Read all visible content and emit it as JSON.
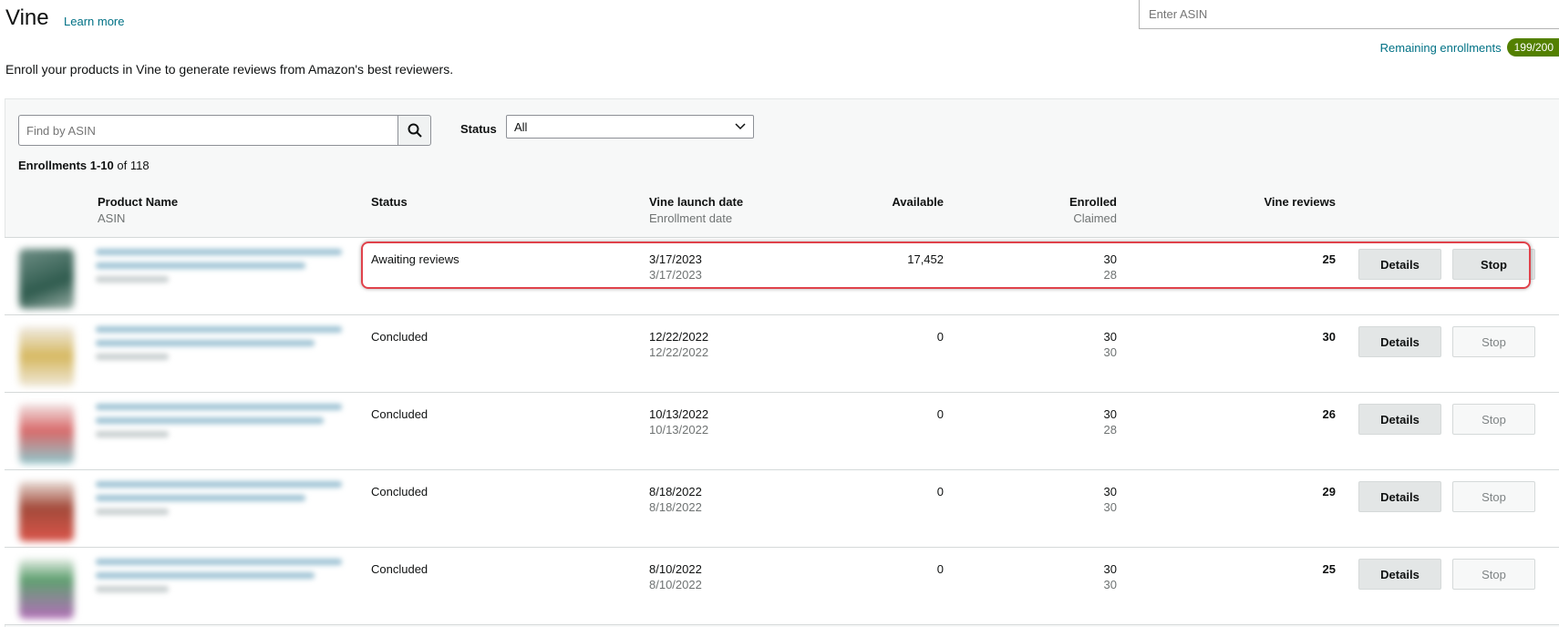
{
  "header": {
    "title": "Vine",
    "learn_more": "Learn more",
    "subtitle": "Enroll your products in Vine to generate reviews from Amazon's best reviewers.",
    "asin_placeholder": "Enter ASIN",
    "remaining_label": "Remaining enrollments",
    "remaining_badge": "199/200"
  },
  "filters": {
    "search_placeholder": "Find by ASIN",
    "status_label": "Status",
    "status_value": "All",
    "enrollments_range": "Enrollments 1-10",
    "enrollments_total": " of 118"
  },
  "columns": {
    "product": "Product Name",
    "product_sub": "ASIN",
    "status": "Status",
    "launch": "Vine launch date",
    "launch_sub": "Enrollment date",
    "available": "Available",
    "enrolled": "Enrolled",
    "enrolled_sub": "Claimed",
    "reviews": "Vine reviews"
  },
  "rows": [
    {
      "status": "Awaiting reviews",
      "launch": "3/17/2023",
      "enrollment": "3/17/2023",
      "available": "17,452",
      "enrolled": "30",
      "claimed": "28",
      "reviews": "25",
      "details": "Details",
      "stop": "Stop"
    },
    {
      "status": "Concluded",
      "launch": "12/22/2022",
      "enrollment": "12/22/2022",
      "available": "0",
      "enrolled": "30",
      "claimed": "30",
      "reviews": "30",
      "details": "Details",
      "stop": "Stop"
    },
    {
      "status": "Concluded",
      "launch": "10/13/2022",
      "enrollment": "10/13/2022",
      "available": "0",
      "enrolled": "30",
      "claimed": "28",
      "reviews": "26",
      "details": "Details",
      "stop": "Stop"
    },
    {
      "status": "Concluded",
      "launch": "8/18/2022",
      "enrollment": "8/18/2022",
      "available": "0",
      "enrolled": "30",
      "claimed": "30",
      "reviews": "29",
      "details": "Details",
      "stop": "Stop"
    },
    {
      "status": "Concluded",
      "launch": "8/10/2022",
      "enrollment": "8/10/2022",
      "available": "0",
      "enrolled": "30",
      "claimed": "30",
      "reviews": "25",
      "details": "Details",
      "stop": "Stop"
    }
  ],
  "colors": {
    "link": "#007185",
    "badge": "#538000",
    "highlight": "#e0424b"
  }
}
